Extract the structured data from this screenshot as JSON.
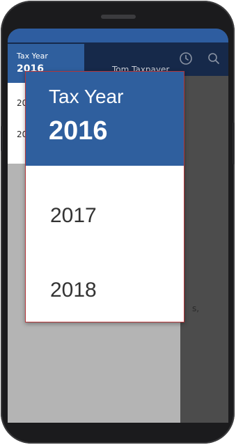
{
  "colors": {
    "accent": "#2f5f9e",
    "app_bar": "#16294a",
    "popup_border": "#b3353a",
    "scrim": "#b4b4b4"
  },
  "app_bar": {
    "title": "Tom Taxpayer",
    "icons": [
      "clock-icon",
      "search-icon"
    ]
  },
  "background_menu": {
    "header_label": "Tax Year",
    "header_year": "2016",
    "items": [
      "20",
      "20"
    ]
  },
  "background_text_fragment": "s,",
  "year_picker": {
    "header_label": "Tax Year",
    "selected_year": "2016",
    "options": [
      "2017",
      "2018"
    ]
  }
}
